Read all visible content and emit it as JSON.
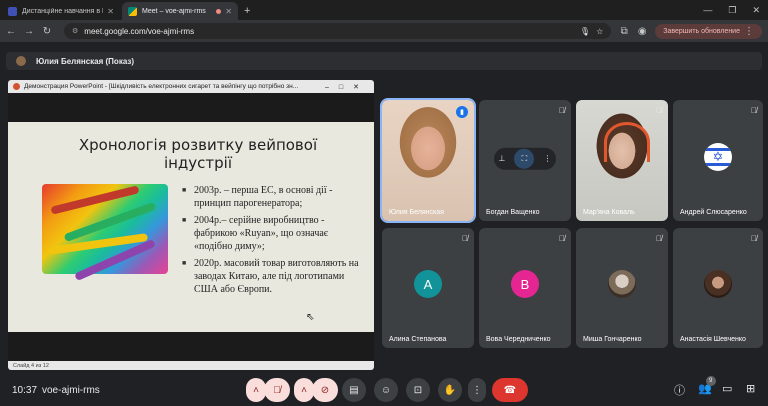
{
  "browser": {
    "tabs": [
      {
        "title": "Дистанційне навчання в ВСП",
        "active": false,
        "favicon_color": "#3f51b5"
      },
      {
        "title": "Meet – voe-ajmi-rms",
        "active": true,
        "favicon_color": "#00897b"
      }
    ],
    "new_tab_glyph": "+",
    "url": "meet.google.com/voe-ajmi-rms",
    "update_button": "Завершить обновление"
  },
  "presenter": {
    "label": "Юлия Белянская (Показ)"
  },
  "presentation": {
    "window_title": "Демонстрация PowerPoint - [Шкідливість електронних сигарет та вейпінгу що потрібно зн...",
    "slide_title": "Хронологія розвитку вейпової індустрії",
    "bullets": [
      "2003р. – перша ЕС, в основі дії - принцип парогенератора;",
      "2004р.– серійне виробництво - фабрикою «Ruyan», що означає «подібно диму»;",
      "2020р. масовий товар виготовляють на заводах Китаю, але під логотипами США або Європи."
    ],
    "status": "Слайд 4 из 12"
  },
  "participants": [
    {
      "name": "Юлия Белянская",
      "type": "video-female-1",
      "speaking": true
    },
    {
      "name": "Богдан Ващенко",
      "type": "menu",
      "muted": true
    },
    {
      "name": "Мар'яна Коваль",
      "type": "video-female-2",
      "muted": true
    },
    {
      "name": "Андрей Слюсаренко",
      "type": "flag-israel",
      "muted": true
    },
    {
      "name": "Алина Степанова",
      "type": "letter",
      "letter": "A",
      "color": "#12939a",
      "muted": true
    },
    {
      "name": "Вова Чередниченко",
      "type": "letter",
      "letter": "B",
      "color": "#e52592",
      "muted": true
    },
    {
      "name": "Миша Гончаренко",
      "type": "photo",
      "color": "#7d6b5a",
      "muted": true
    },
    {
      "name": "Анастасія Шевченко",
      "type": "photo",
      "color": "#4a3022",
      "muted": true
    }
  ],
  "meeting": {
    "time": "10:37",
    "code": "voe-ajmi-rms",
    "people_count": "9"
  },
  "colors": {
    "background": "#202124",
    "tile": "#3c4043",
    "hangup": "#dc362e",
    "mic_off": "#f9dedc"
  }
}
